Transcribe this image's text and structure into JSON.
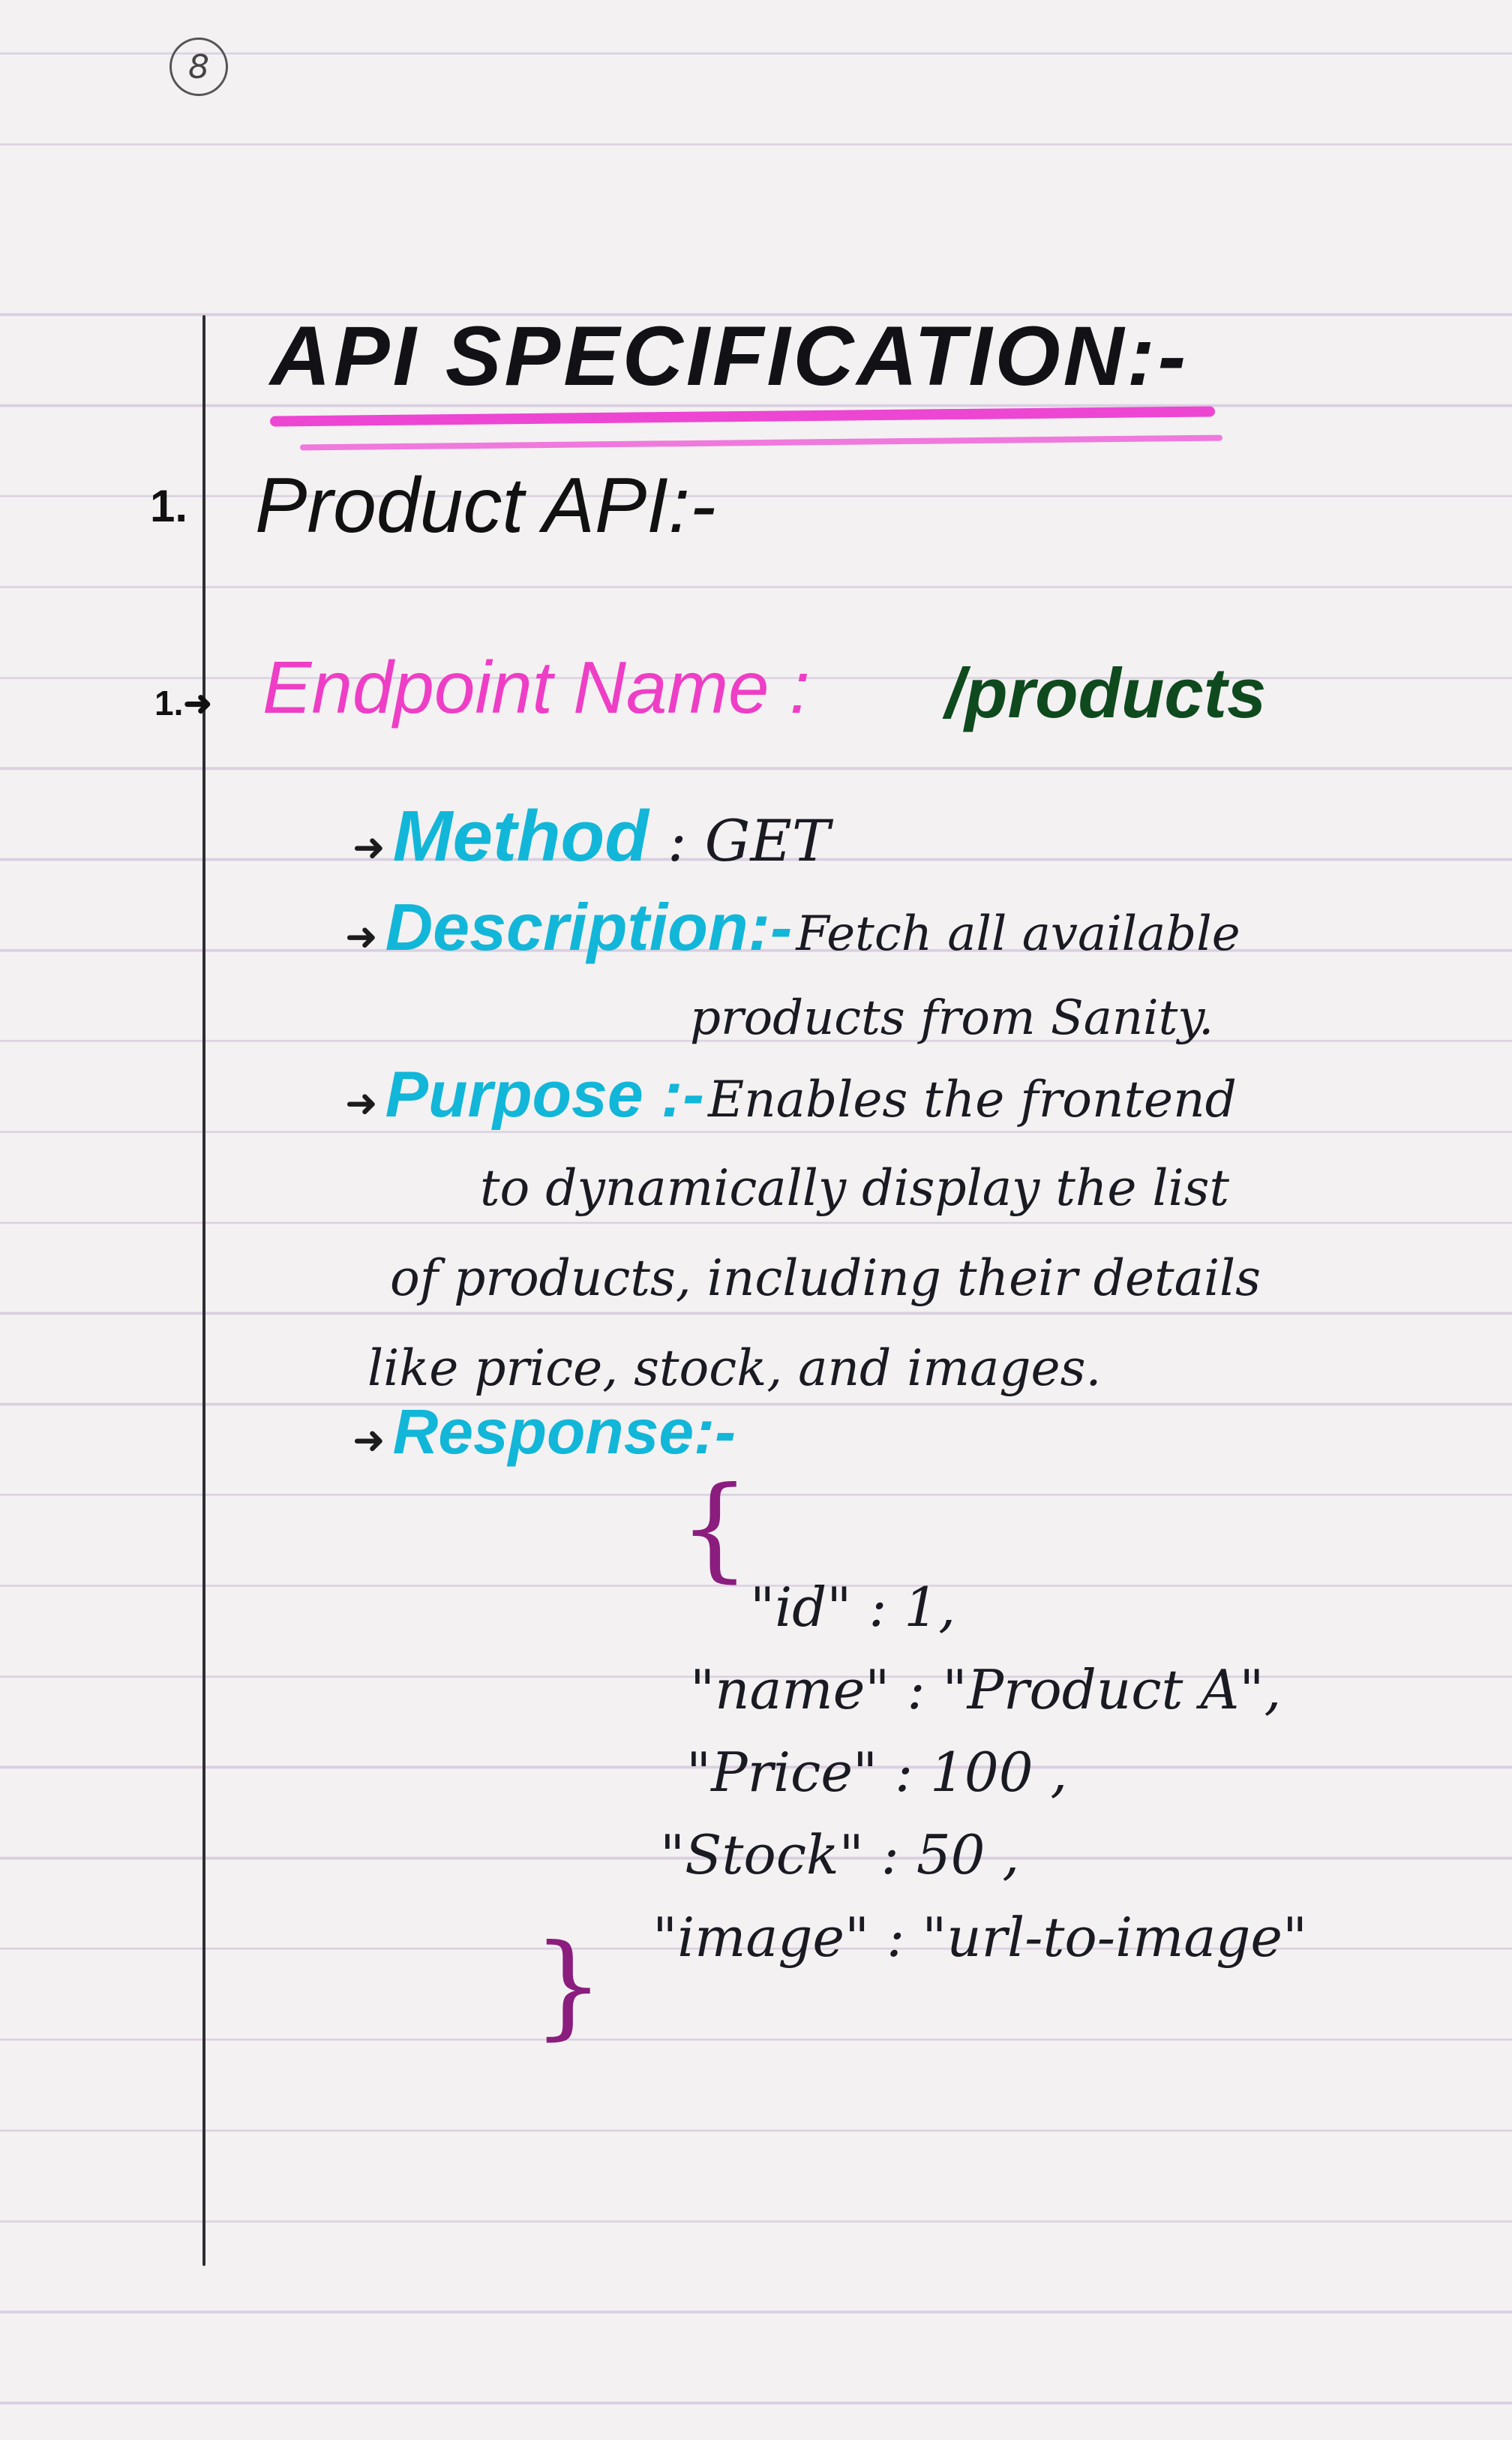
{
  "page_number": "8",
  "title": "API SPECIFICATION:-",
  "section": {
    "number": "1.",
    "heading": "Product API:-"
  },
  "endpoint": {
    "number": "1.",
    "label": "Endpoint Name :",
    "value": "/products"
  },
  "method": {
    "label": "Method",
    "value": ": GET"
  },
  "description": {
    "label": "Description:-",
    "lines": [
      "Fetch all available",
      "products from Sanity."
    ]
  },
  "purpose": {
    "label": "Purpose :-",
    "lines": [
      "Enables the frontend",
      "to dynamically display the list",
      "of products, including their details",
      "like price, stock, and images."
    ]
  },
  "response": {
    "label": "Response:-",
    "open_brace": "{",
    "close_brace": "}",
    "lines": [
      "\"id\" : 1,",
      "\"name\" : \"Product A\",",
      "\"Price\" : 100 ,",
      "\"Stock\" : 50 ,",
      "\"image\" : \"url-to-image\""
    ]
  },
  "colors": {
    "heading_underline": "#ec46d3",
    "endpoint_label": "#ee3ec6",
    "endpoint_value": "#0e4a1e",
    "field_labels": "#12b6d8",
    "braces": "#8a1d7e",
    "ink": "#1a1a22"
  }
}
